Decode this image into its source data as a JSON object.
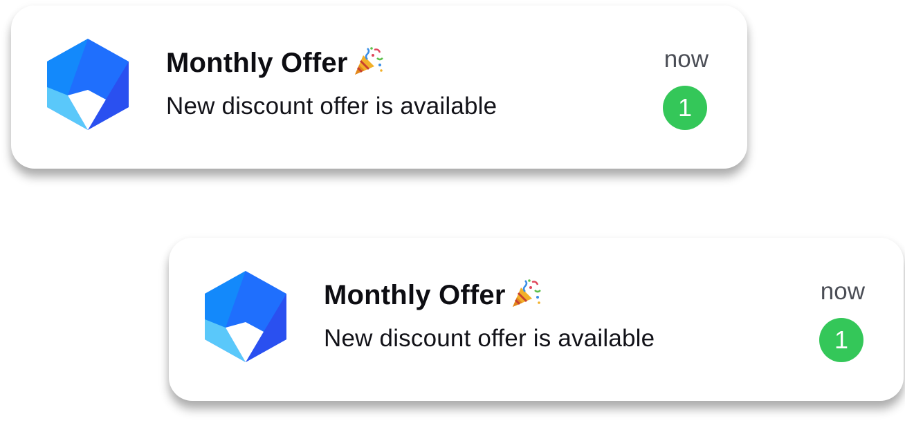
{
  "notifications": [
    {
      "app_icon": "hexagon-app-icon",
      "title": "Monthly Offer",
      "title_emoji": "party-popper-icon",
      "message": "New discount offer is available",
      "time": "now",
      "badge_count": "1"
    },
    {
      "app_icon": "hexagon-app-icon",
      "title": "Monthly Offer",
      "title_emoji": "party-popper-icon",
      "message": "New discount offer is available",
      "time": "now",
      "badge_count": "1"
    }
  ],
  "colors": {
    "badge": "#34c759",
    "icon_blue": "#1a6dfb",
    "icon_light": "#5ac8fa",
    "icon_dark": "#2b4ff0"
  }
}
